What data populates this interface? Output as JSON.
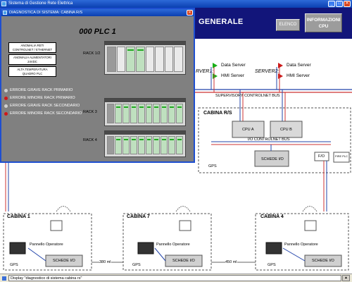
{
  "window": {
    "title": "Sistema di Gestione Rete Elettrica",
    "minimize": "_",
    "maximize": "□",
    "close": "✕"
  },
  "header": {
    "title": "GENERALE",
    "elenco_button": "ELENCO",
    "info_button_line1": "INFORMAZIONI",
    "info_button_line2": "CPU"
  },
  "servers": {
    "server1_label": "RVER1:",
    "server2_label": "SERVER2:",
    "items": [
      {
        "label": "Data Server",
        "status": "green"
      },
      {
        "label": "HMI Server",
        "status": "green"
      },
      {
        "label": "Data Server",
        "status": "red"
      },
      {
        "label": "HMI Server",
        "status": "red"
      }
    ]
  },
  "plant": {
    "bus_label": "SUPERVISORY CONTROLNET BUS",
    "cabina_rs": "CABINA R/S",
    "cpu_a": "CPU A",
    "cpu_b": "CPU B",
    "io_bus": "I/O CONTROLNET BUS",
    "schede_io": "SCHEDE I/O",
    "gps": "GPS",
    "fo": "F/O",
    "pc_fo": "F/O",
    "pc_label": "FIRE PLC",
    "cabine": [
      {
        "name": "CABINA 1",
        "panel": "Pannello Operatore",
        "gps": "GPS",
        "schede": "SCHEDE I/O"
      },
      {
        "name": "CABINA 7",
        "panel": "Pannello Operatore",
        "gps": "GPS",
        "schede": "SCHEDE I/O"
      },
      {
        "name": "CABINA 4",
        "panel": "Pannello Operatore",
        "gps": "GPS",
        "schede": "SCHEDE I/O"
      }
    ],
    "distance_1": "380 ml",
    "distance_2": "450 ml"
  },
  "diagnostic": {
    "title": "DIAGNOSTICA DI SISTEMA: CABINA R/S",
    "close": "✕",
    "plc_title": "000 PLC 1",
    "alarms": [
      {
        "line1": "ANOMALIA RETI",
        "line2": "CONTROLNET / ETHERNET"
      },
      {
        "line1": "ANOMALIA ALIMENTATORI",
        "line2": "24VDC"
      },
      {
        "line1": "ALTA TEMPERATURA",
        "line2": "QUADRO PLC"
      }
    ],
    "racks": [
      {
        "label": "RACK 1/2"
      },
      {
        "label": "RACK 3"
      },
      {
        "label": "RACK 4"
      }
    ],
    "errors": [
      {
        "label": "ERRORE GRAVE RACK PRIMARIO",
        "state": "grey"
      },
      {
        "label": "ERRORE MINORE RACK PRIMARIO",
        "state": "red"
      },
      {
        "label": "ERRORE GRAVE RACK SECONDARIO",
        "state": "grey"
      },
      {
        "label": "ERRORE MINORE RACK SECONDARIO",
        "state": "red"
      }
    ]
  },
  "statusbar": {
    "text": "Display \"diagnostico di sistema cabina rs\"",
    "scroll": "▲"
  },
  "colors": {
    "header_bg": "#12157a",
    "titlebar": "#0a3fb0",
    "diag_bg": "#808080",
    "ok": "#18b018",
    "alarm": "#cc1a1a"
  }
}
